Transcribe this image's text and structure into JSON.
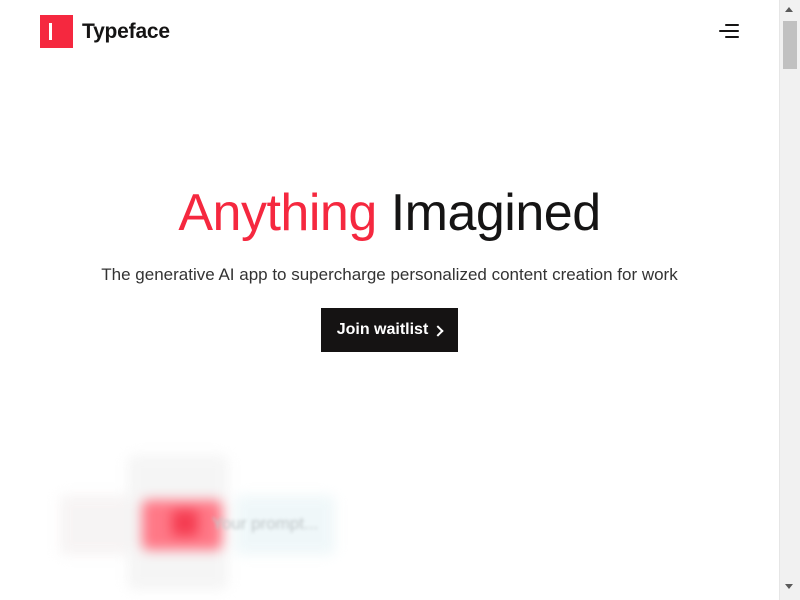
{
  "header": {
    "brand_name": "Typeface",
    "logo_icon": "typeface-logo-icon",
    "menu_icon": "hamburger-menu-icon"
  },
  "hero": {
    "title_accent": "Anything",
    "title_rest": "Imagined",
    "subtitle": "The generative AI app to supercharge personalized content creation for work",
    "cta_label": "Join waitlist",
    "cta_icon": "chevron-right-icon"
  },
  "preview": {
    "prompt_placeholder": "Your prompt..."
  },
  "colors": {
    "accent": "#f5283f",
    "text_dark": "#151414",
    "button_bg": "#151313"
  }
}
